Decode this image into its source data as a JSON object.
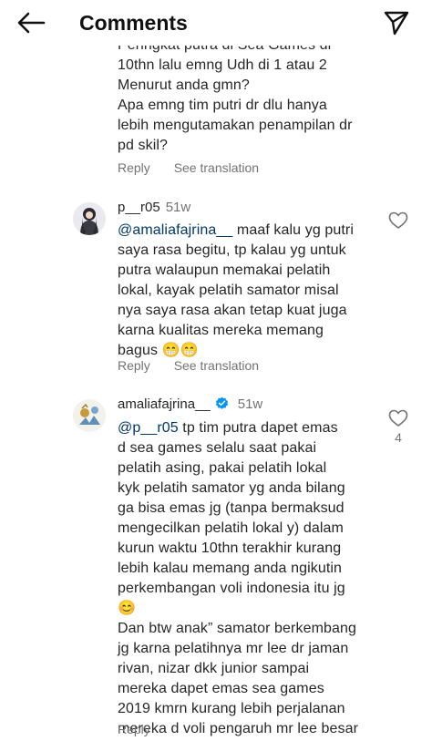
{
  "header": {
    "title": "Comments"
  },
  "icons": {
    "back": "arrow-left-icon",
    "send": "send-icon",
    "heart": "heart-icon",
    "verified": "verified-badge-icon"
  },
  "colors": {
    "mention": "#00376b",
    "secondary_text": "#737373",
    "verified": "#0095f6"
  },
  "comments": [
    {
      "lines": [
        "Peringkat putra di Sea Games dr",
        "10thn lalu emng Udh di 1 atau 2",
        "Menurut anda gmn?",
        "Apa emng tim putri dr dlu hanya",
        "lebih mengutamakan penampilan dr",
        "pd skil?"
      ],
      "reply": "Reply",
      "translate": "See translation"
    },
    {
      "username": "p__r05",
      "time": "51w",
      "mention": "@amaliafajrina__",
      "first_line_rest": " maaf kalu yg putri",
      "lines": [
        "saya rasa begitu, tp kalau yg untuk",
        "putra walaupun memakai pelatih",
        "lokal, kayak pelatih samator misal",
        "nya saya rasa akan tetap kuat juga",
        "karna kualitas mereka memang",
        "bagus 😁😁"
      ],
      "reply": "Reply",
      "translate": "See translation"
    },
    {
      "username": "amaliafajrina__",
      "time": "51w",
      "likes": "4",
      "mention": "@p__r05",
      "first_line_rest": " tp tim putra dapet emas",
      "lines": [
        "d sea games selalu saat pakai",
        "pelatih asing, pakai pelatih lokal",
        "kyk pelatih samator yg anda bilang",
        "ga bisa emas jg (tanpa bermaksud",
        "mengecilkan pelatih lokal y) dalam",
        "kurun waktu 10thn terakhir kurang",
        "lebih kalau memang anda ngikutin",
        "perkembangan voli indonesia itu jg",
        "😊",
        "Dan btw anak” samator berkembang",
        "jg karna pelatihnya mr lee dr jaman",
        "rivan, nizar dkk junior sampai",
        "mereka dapet emas sea games",
        "2019 kmrn kurang lebih perjalanan",
        "mereka d voli pengaruh mr lee besar"
      ],
      "reply": "Reply"
    }
  ]
}
